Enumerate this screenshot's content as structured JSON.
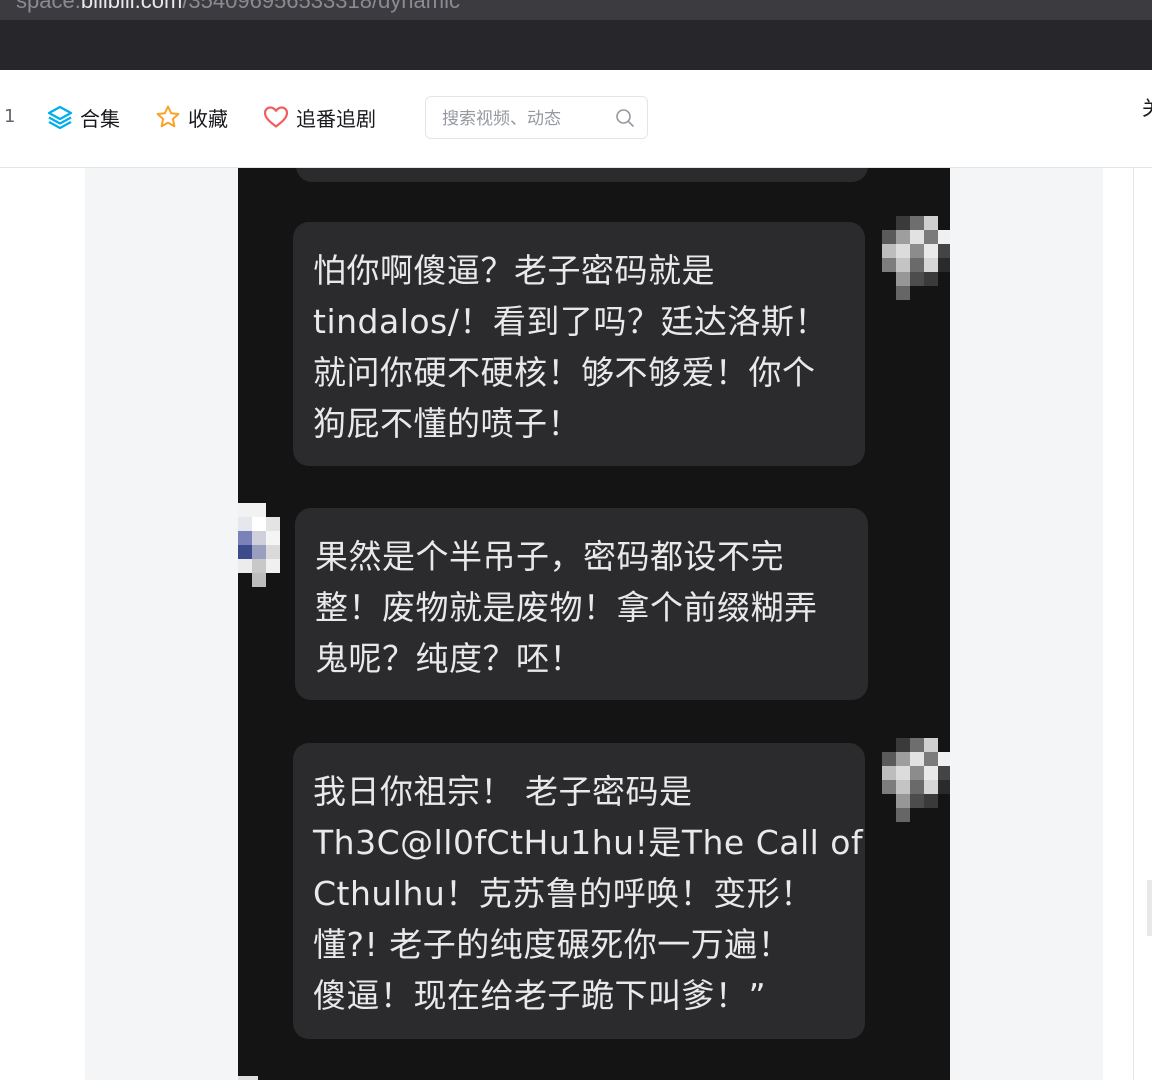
{
  "browser": {
    "url_host_prefix": "space.",
    "url_host": "bilibili.com",
    "url_path": "/354096956533318/dynamic"
  },
  "nav": {
    "left_count": "1",
    "items": [
      {
        "label": "合集",
        "icon": "layers-icon"
      },
      {
        "label": "收藏",
        "icon": "star-icon"
      },
      {
        "label": "追番追剧",
        "icon": "heart-icon"
      }
    ],
    "search_placeholder": "搜索视频、动态",
    "right_partial": "关"
  },
  "colors": {
    "accent_blue": "#00aeec",
    "star_orange": "#f6a52a",
    "heart_red": "#f25d5d",
    "chat_background": "#141414",
    "bubble_background": "#2b2b2d"
  },
  "chat": {
    "messages": [
      {
        "side": "right",
        "lines": [
          "怕你啊傻逼？老子密码就是",
          "tindalos/！看到了吗？廷达洛斯！",
          "就问你硬不硬核！够不够爱！你个",
          "狗屁不懂的喷子！"
        ]
      },
      {
        "side": "left",
        "lines": [
          "果然是个半吊子，密码都设不完",
          "整！废物就是废物！拿个前缀糊弄",
          "鬼呢？纯度？呸！"
        ]
      },
      {
        "side": "right",
        "lines": [
          "我日你祖宗！ 老子密码是",
          "Th3C@ll0fCtHu1hu!是The Call of",
          "Cthulhu！克苏鲁的呼唤！变形！",
          "懂?! 老子的纯度碾死你一万遍！",
          "傻逼！现在给老子跪下叫爹！”"
        ]
      }
    ]
  }
}
